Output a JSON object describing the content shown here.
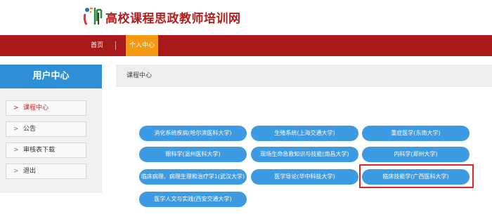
{
  "site": {
    "title": "高校课程思政教师培训网",
    "logo_text": "师"
  },
  "nav": {
    "items": [
      {
        "label": "首页"
      },
      {
        "label": "个人中心"
      }
    ]
  },
  "sidebar": {
    "title": "用户中心",
    "chevron": ">",
    "items": [
      {
        "label": "课程中心",
        "active": true
      },
      {
        "label": "公告"
      },
      {
        "label": "审核表下载"
      },
      {
        "label": "退出"
      }
    ]
  },
  "main": {
    "title": "课程中心",
    "courses": [
      {
        "label": "消化系统疾病(哈尔滨医科大学)"
      },
      {
        "label": "生殖系统(上海交通大学)"
      },
      {
        "label": "重症医学(东南大学)"
      },
      {
        "label": "眼科学(温州医科大学)"
      },
      {
        "label": "现场生命急救知识与技能(南昌大学)"
      },
      {
        "label": "内科学(郑州大学)"
      },
      {
        "label": "临床病理、病理生理和治疗学1(武汉大学)"
      },
      {
        "label": "医学导论(华中科技大学)"
      },
      {
        "label": "临床技能学(广西医科大学)",
        "highlighted": true
      },
      {
        "label": "医学人文与实践(西安交通大学)"
      }
    ]
  },
  "colors": {
    "brand_red": "#a81a1a",
    "nav_active": "#f39a12",
    "sidebar_head": "#2f8fd6",
    "course_button": "#3d9be3",
    "highlight": "#e0252a"
  }
}
